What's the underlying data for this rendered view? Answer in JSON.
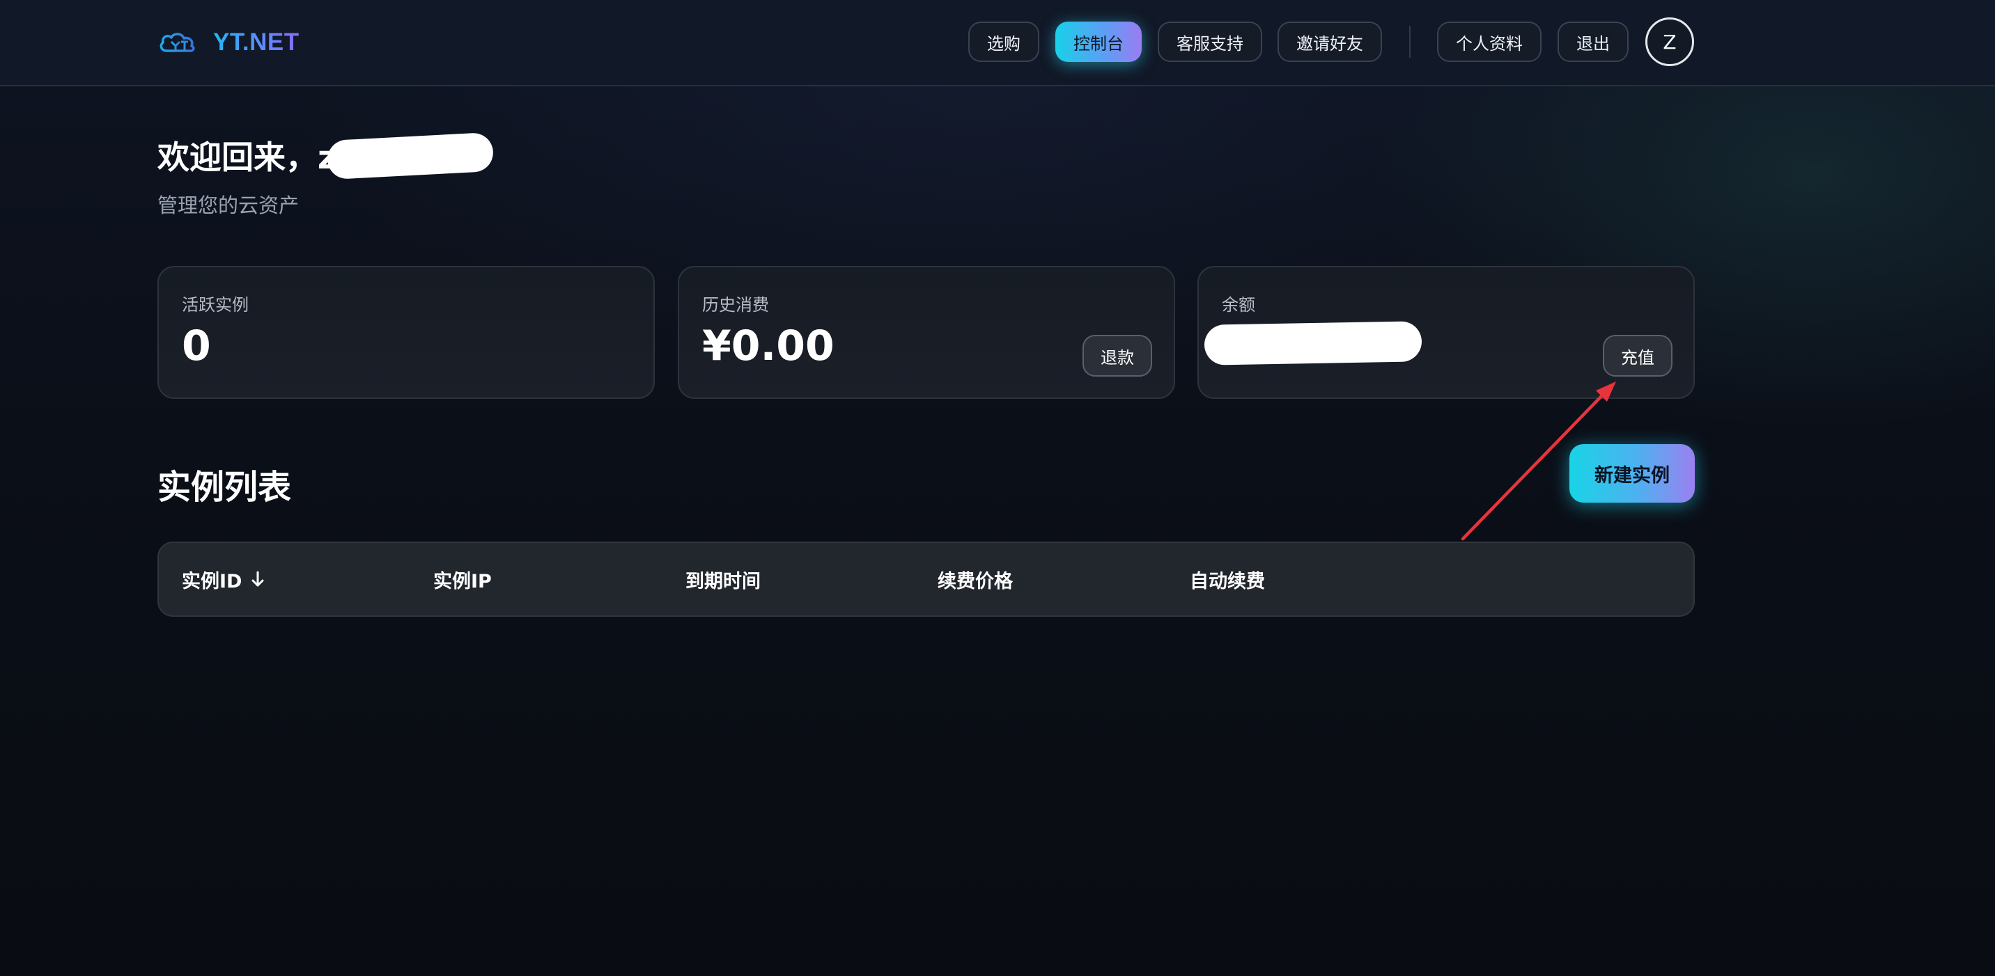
{
  "header": {
    "brand": "YT.NET",
    "nav": [
      {
        "label": "选购",
        "active": false
      },
      {
        "label": "控制台",
        "active": true
      },
      {
        "label": "客服支持",
        "active": false
      },
      {
        "label": "邀请好友",
        "active": false
      }
    ],
    "user_nav": [
      {
        "label": "个人资料"
      },
      {
        "label": "退出"
      }
    ],
    "avatar_initial": "Z"
  },
  "welcome": {
    "title": "欢迎回来，z",
    "subtitle": "管理您的云资产"
  },
  "stats": {
    "active_instances": {
      "label": "活跃实例",
      "value": "0"
    },
    "history_spend": {
      "label": "历史消费",
      "value": "¥0.00",
      "button": "退款"
    },
    "balance": {
      "label": "余额",
      "button": "充值"
    }
  },
  "instances": {
    "title": "实例列表",
    "new_button": "新建实例",
    "columns": [
      "实例ID",
      "实例IP",
      "到期时间",
      "续费价格",
      "自动续费"
    ]
  },
  "colors": {
    "accent_start": "#19d0e8",
    "accent_end": "#9b7cf2",
    "annotation_arrow": "#e8343c"
  }
}
